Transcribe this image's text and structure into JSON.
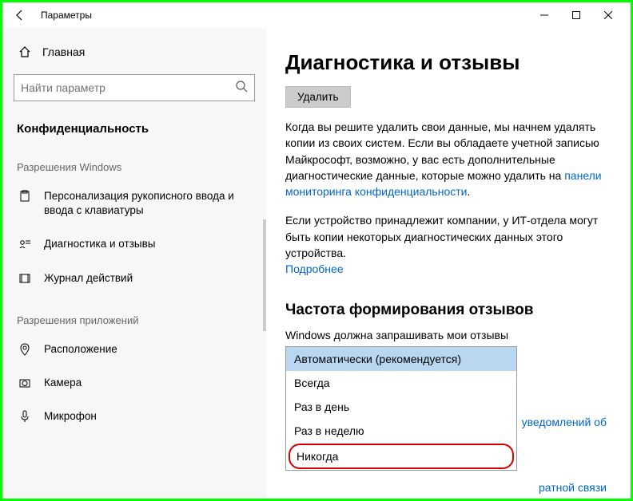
{
  "window": {
    "title": "Параметры"
  },
  "sidebar": {
    "home": "Главная",
    "search_placeholder": "Найти параметр",
    "category": "Конфиденциальность",
    "section1": "Разрешения Windows",
    "items1": [
      {
        "label": "Персонализация рукописного ввода и ввода с клавиатуры"
      },
      {
        "label": "Диагностика и отзывы"
      },
      {
        "label": "Журнал действий"
      }
    ],
    "section2": "Разрешения приложений",
    "items2": [
      {
        "label": "Расположение"
      },
      {
        "label": "Камера"
      },
      {
        "label": "Микрофон"
      }
    ]
  },
  "main": {
    "heading": "Диагностика и отзывы",
    "delete_btn": "Удалить",
    "para1a": "Когда вы решите удалить свои данные, мы начнем удалять копии из своих систем. Если вы обладаете учетной записью Майкрософт, возможно, у вас есть дополнительные диагностические данные, которые можно удалить на ",
    "link1": "панели мониторинга конфиденциальности",
    "para1b": ".",
    "para2a": "Если устройство принадлежит компании, у ИТ-отдела могут быть копии некоторых диагностических данных этого устройства. ",
    "link2": "Подробнее",
    "section2": "Частота формирования отзывов",
    "freq_label": "Windows должна запрашивать мои отзывы",
    "options": [
      "Автоматически (рекомендуется)",
      "Всегда",
      "Раз в день",
      "Раз в неделю",
      "Никогда"
    ],
    "behind_link1": "уведомлений об",
    "behind_link2": "ратной связи"
  }
}
